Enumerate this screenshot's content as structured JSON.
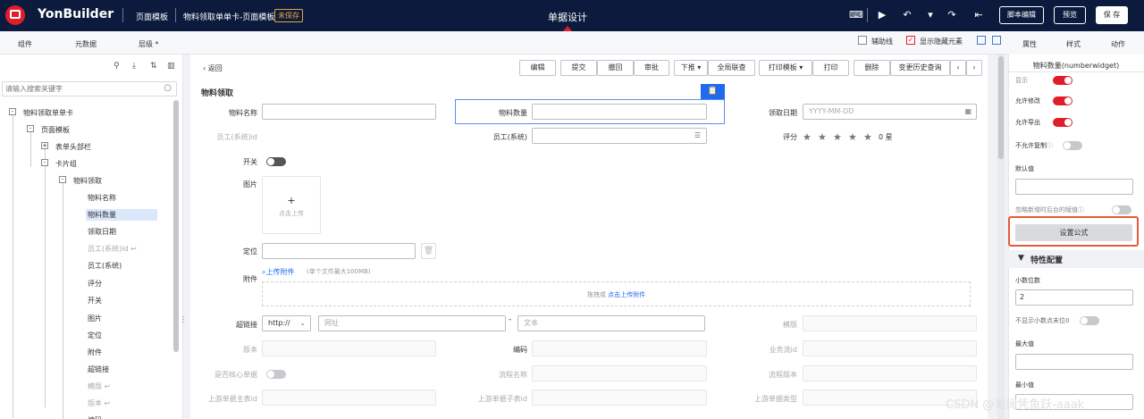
{
  "topbar": {
    "brand": "YonBuilder",
    "crumb1": "页面模板",
    "crumb2": "物料领取单单卡-页面模板",
    "unsaved": "未保存",
    "center_title": "单据设计",
    "script_edit": "脚本编辑",
    "preview": "预览",
    "save": "保 存"
  },
  "subbar": {
    "tabs": [
      "组件",
      "元数据",
      "层级 *"
    ],
    "aux_line": "辅助线",
    "show_hidden": "显示隐藏元素",
    "right_tabs": [
      "属性",
      "样式",
      "动作"
    ]
  },
  "left": {
    "search_placeholder": "请输入搜索关键字",
    "tree": [
      {
        "label": "物料领取单单卡",
        "box": "-"
      },
      {
        "label": "页面模板",
        "box": "-"
      },
      {
        "label": "表单头部栏",
        "box": "+"
      },
      {
        "label": "卡片组",
        "box": "-"
      },
      {
        "label": "物料领取",
        "box": "-"
      },
      {
        "label": "物料名称"
      },
      {
        "label": "物料数量"
      },
      {
        "label": "领取日期"
      },
      {
        "label": "员工(系统)id ↩"
      },
      {
        "label": "员工(系统)"
      },
      {
        "label": "评分"
      },
      {
        "label": "开关"
      },
      {
        "label": "图片"
      },
      {
        "label": "定位"
      },
      {
        "label": "附件"
      },
      {
        "label": "超链接"
      },
      {
        "label": "模版 ↩"
      },
      {
        "label": "版本 ↩"
      },
      {
        "label": "编码"
      }
    ]
  },
  "main": {
    "back": "返回",
    "buttons": [
      "编辑",
      "提交",
      "撤回",
      "审批",
      "下推",
      "全局联查",
      "打印模板",
      "打印",
      "删除",
      "变更历史查询"
    ],
    "form_title": "物料领取",
    "fields": {
      "material_name": "物料名称",
      "material_qty": "物料数量",
      "receive_date": "领取日期",
      "date_placeholder": "YYYY-MM-DD",
      "employee_id": "员工(系统)id",
      "employee": "员工(系统)",
      "rating": "评分",
      "rating_value": "0 星",
      "switch": "开关",
      "image": "图片",
      "upload_plus": "+",
      "upload_text": "点击上传",
      "location": "定位",
      "attachment": "附件",
      "upload_attachment": "上传附件",
      "attach_limit": "(单个文件最大100MB)",
      "drop_text": "拖拽或",
      "drop_link": "点击上传附件",
      "hyperlink": "超链接",
      "protocol": "http://",
      "url_placeholder": "网址",
      "dash": "-",
      "text_placeholder": "文本",
      "template": "模版",
      "version": "版本",
      "code": "编码",
      "business_flow_id": "业务流id",
      "is_core_doc": "是否核心单据",
      "flow_name": "流程名称",
      "flow_version": "流程版本",
      "upstream_main_id": "上游单据主表id",
      "upstream_sub_id": "上游单据子表id",
      "upstream_type": "上游单据类型"
    }
  },
  "right": {
    "component_title": "物料数量(numberwidget)",
    "show": "显示",
    "allow_edit": "允许修改",
    "allow_export": "允许导出",
    "no_copy": "不允许复制",
    "default_value": "默认值",
    "ignore_backend": "忽略新增时后台的赋值",
    "set_formula": "设置公式",
    "feature_config": "特性配置",
    "decimal_places": "小数位数",
    "decimal_value": "2",
    "hide_trailing_zero": "不显示小数点末位0",
    "max_value": "最大值",
    "min_value": "最小值"
  },
  "watermark": "CSDN @海阔凭鱼跃-aaak"
}
